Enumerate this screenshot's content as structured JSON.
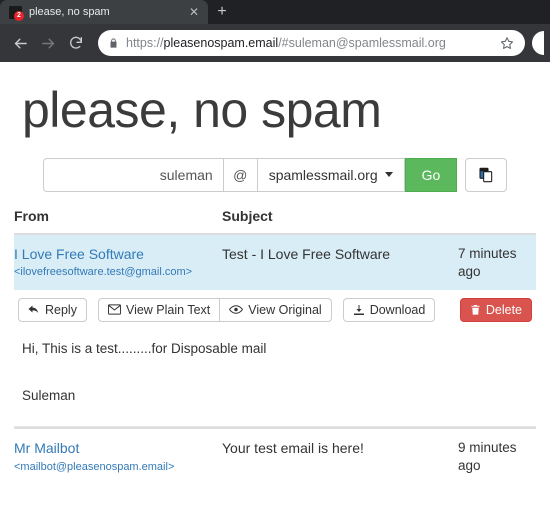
{
  "browser": {
    "tab": {
      "title": "please, no spam",
      "favicon_icon": "mail-badge-favicon",
      "unread_badge": "2",
      "close_icon": "close-icon"
    },
    "new_tab_icon": "plus-icon",
    "nav": {
      "back_icon": "arrow-left-icon",
      "forward_icon": "arrow-right-icon",
      "reload_icon": "reload-icon"
    },
    "omnibox": {
      "lock_icon": "lock-icon",
      "url_scheme": "https://",
      "url_host": "pleasenospam.email",
      "url_path": "/#suleman@spamlessmail.org",
      "url_full": "https://pleasenospam.email/#suleman@spamlessmail.org",
      "star_icon": "star-icon"
    }
  },
  "page": {
    "site_title": "please, no spam",
    "address_form": {
      "user_value": "suleman",
      "user_placeholder": "suleman",
      "at_separator": "@",
      "domain_selected": "spamlessmail.org",
      "domain_options": [
        "spamlessmail.org"
      ],
      "go_label": "Go",
      "copy_icon": "copy-icon"
    },
    "mail_table": {
      "headers": {
        "from": "From",
        "subject": "Subject",
        "time": ""
      },
      "rows": [
        {
          "sender_name": "I Love Free Software",
          "sender_address": "<ilovefreesoftware.test@gmail.com>",
          "subject": "Test - I Love Free Software",
          "time": "7 minutes ago",
          "selected": true
        },
        {
          "sender_name": "Mr Mailbot",
          "sender_address": "<mailbot@pleasenospam.email>",
          "subject": "Your test email is here!",
          "time": "9 minutes ago",
          "selected": false
        }
      ]
    },
    "detail": {
      "actions": {
        "reply_label": "Reply",
        "reply_icon": "reply-arrow-icon",
        "view_plain_label": "View Plain Text",
        "view_plain_icon": "envelope-icon",
        "view_original_label": "View Original",
        "view_original_icon": "eye-icon",
        "download_label": "Download",
        "download_icon": "download-icon",
        "delete_label": "Delete",
        "delete_icon": "trash-icon"
      },
      "body_line_1": "Hi, This is a test.........for Disposable mail",
      "body_line_2": "Suleman"
    }
  },
  "colors": {
    "accent_link": "#337ab7",
    "row_highlight": "#d9edf7",
    "go_green": "#5cb85c",
    "delete_red": "#d9534f",
    "chrome_dark": "#202124",
    "toolbar_dark": "#35363a"
  }
}
